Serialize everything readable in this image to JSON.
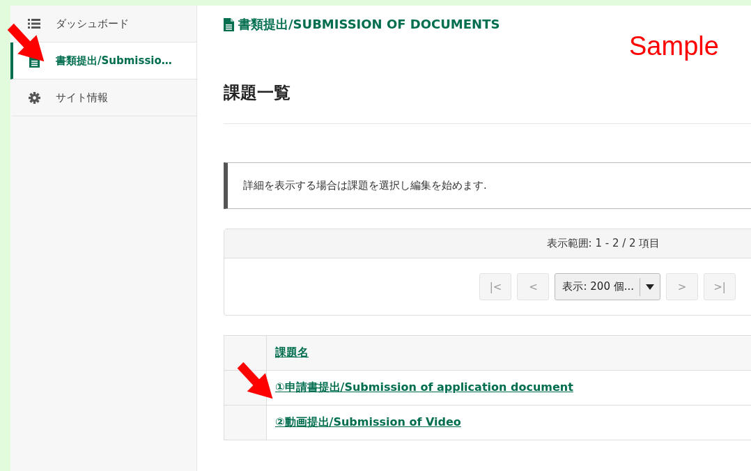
{
  "sidebar": {
    "items": [
      {
        "label": "ダッシュボード",
        "kind": "list",
        "selected": false
      },
      {
        "label": "書類提出/Submissio…",
        "kind": "document",
        "selected": true
      },
      {
        "label": "サイト情報",
        "kind": "gear",
        "selected": false
      }
    ]
  },
  "page_title": "書類提出/SUBMISSION OF DOCUMENTS",
  "annotation_label": "Sample",
  "heading": "課題一覧",
  "info": "詳細を表示する場合は課題を選択し編集を始めます.",
  "pager": {
    "range": "表示範囲: 1 - 2 / 2 項目",
    "first": "|<",
    "prev": "<",
    "page_size": "表示: 200 個...",
    "next": ">",
    "last": ">|"
  },
  "table": {
    "columns": [
      "課題名"
    ],
    "rows": [
      {
        "title": "①申請書提出/Submission of application document"
      },
      {
        "title": "②動画提出/Submission of Video"
      }
    ]
  }
}
